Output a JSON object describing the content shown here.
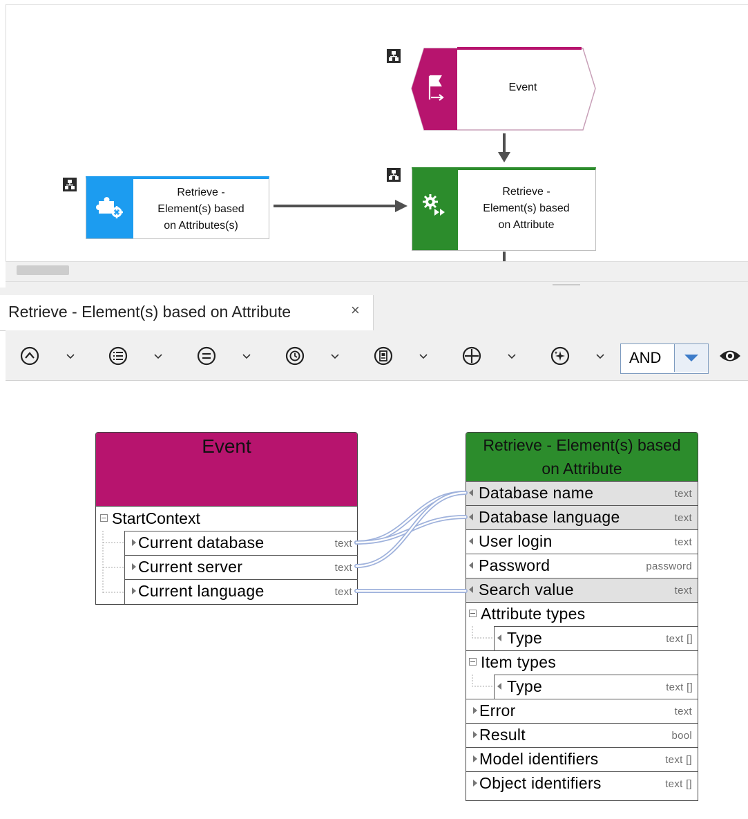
{
  "diagram": {
    "event_label": "Event",
    "function_green_label_lines": [
      "Retrieve -",
      "Element(s) based",
      "on Attribute"
    ],
    "function_blue_label_lines": [
      "Retrieve -",
      "Element(s) based",
      "on Attributes(s)"
    ],
    "colors": {
      "event": "#b7146e",
      "function_green": "#2c8c2c",
      "function_blue": "#1c9cf0",
      "connector": "#505050"
    }
  },
  "tab": {
    "title": "Retrieve - Element(s) based on Attribute",
    "close_icon": "×"
  },
  "toolbar": {
    "buttons": [
      "caret-up-circle-icon",
      "list-circle-icon",
      "equals-circle-icon",
      "clock-circle-icon",
      "document-icon",
      "plus-circle-icon",
      "sparkle-circle-icon"
    ],
    "operator": "AND",
    "view_icon": "eye-icon"
  },
  "source_card": {
    "title": "Event",
    "group": "StartContext",
    "rows": [
      {
        "label": "Current database",
        "type": "text"
      },
      {
        "label": "Current server",
        "type": "text"
      },
      {
        "label": "Current language",
        "type": "text"
      }
    ]
  },
  "target_card": {
    "title_lines": [
      "Retrieve - Element(s) based",
      "on Attribute"
    ],
    "rows": [
      {
        "label": "Database name",
        "type": "text"
      },
      {
        "label": "Database language",
        "type": "text"
      },
      {
        "label": "User login",
        "type": "text"
      },
      {
        "label": "Password",
        "type": "password"
      },
      {
        "label": "Search value",
        "type": "text"
      },
      {
        "label": "Attribute types",
        "type": ""
      },
      {
        "label": "Type",
        "type": "text []"
      },
      {
        "label": "Item types",
        "type": ""
      },
      {
        "label": "Type",
        "type": "text []"
      },
      {
        "label": "Error",
        "type": "text"
      },
      {
        "label": "Result",
        "type": "bool"
      },
      {
        "label": "Model identifiers",
        "type": "text []"
      },
      {
        "label": "Object identifiers",
        "type": "text []"
      }
    ]
  }
}
